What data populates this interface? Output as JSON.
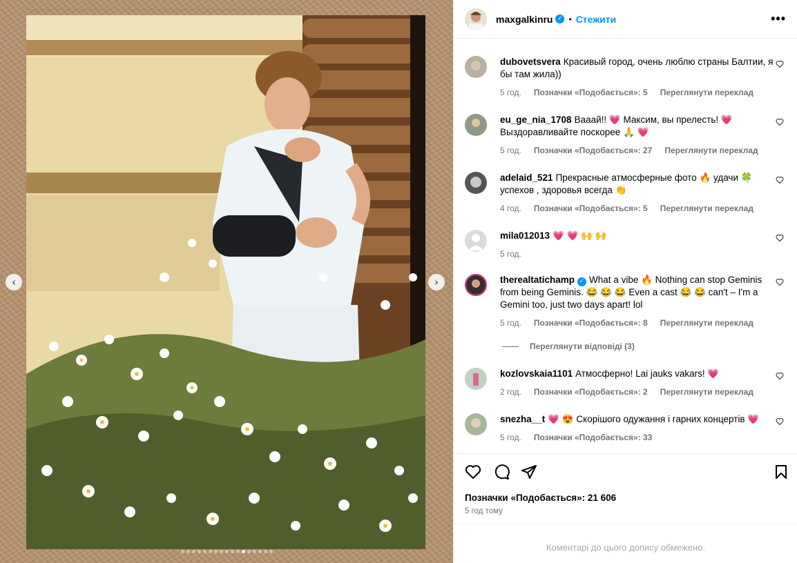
{
  "post": {
    "username": "maxgalkinru",
    "follow_label": "Стежити",
    "more_icon": "•••",
    "likes_text": "Позначки «Подобається»: 21 606",
    "time_ago": "5 год тому",
    "comments_limited": "Коментарі до цього допису обмежено."
  },
  "carousel": {
    "total": 17,
    "active_index": 11
  },
  "comments": [
    {
      "user": "dubovetsvera",
      "text": "Красивый город, очень люблю страны Балтии, я бы там жила))",
      "time": "5 год.",
      "likes": "Позначки «Подобається»: 5",
      "translate": "Переглянути переклад"
    },
    {
      "user": "eu_ge_nia_1708",
      "text": "Вааай!! 💗 Максим, вы прелесть! 💗 Выздоравливайте поскорее 🙏 💗",
      "time": "5 год.",
      "likes": "Позначки «Подобається»: 27",
      "translate": "Переглянути переклад"
    },
    {
      "user": "adelaid_521",
      "text": "Прекрасные атмосферные фото 🔥 удачи 🍀 успехов , здоровья всегда 👏",
      "time": "4 год.",
      "likes": "Позначки «Подобається»: 5",
      "translate": "Переглянути переклад"
    },
    {
      "user": "mila012013",
      "text": "💗 💗 🙌 🙌",
      "time": "5 год.",
      "likes": "",
      "translate": ""
    },
    {
      "user": "therealtatichamp",
      "text": "What a vibe 🔥 Nothing can stop Geminis from being Geminis. 😂 😂 😂 Even a cast 😂 😂 can't – I'm a Gemini too, just two days apart! lol",
      "time": "5 год.",
      "likes": "Позначки «Подобається»: 8",
      "translate": "Переглянути переклад"
    },
    {
      "user": "kozlovskaia1101",
      "text": "Атмосферно! Lai jauks vakars! 💗",
      "time": "2 год.",
      "likes": "Позначки «Подобається»: 2",
      "translate": "Переглянути переклад"
    },
    {
      "user": "snezha__t",
      "text": "💗 😍 Скорішого одужання і гарних концертів 💗",
      "time": "5 год.",
      "likes": "Позначки «Подобається»: 33",
      "translate": ""
    }
  ],
  "replies_label": "Переглянути відповіді (3)",
  "colors": {
    "accent": "#0095f6",
    "muted": "#737373",
    "border": "#efefef"
  }
}
